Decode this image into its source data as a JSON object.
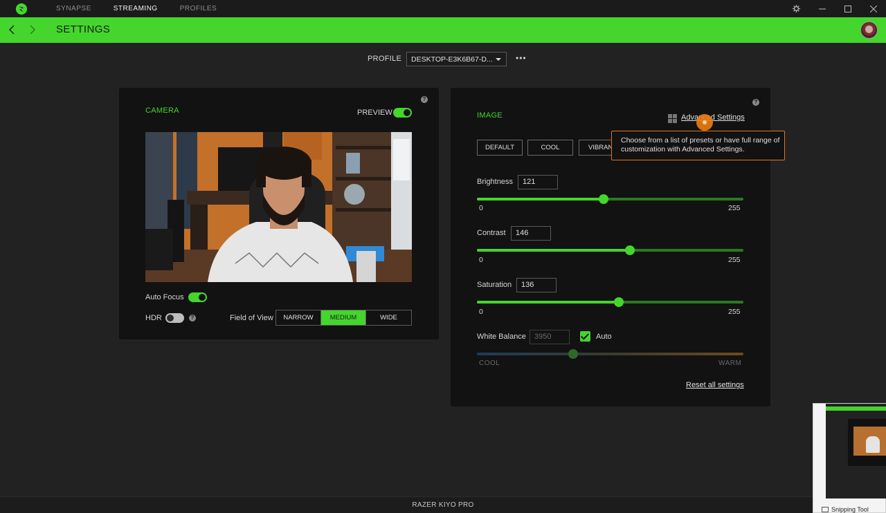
{
  "titlebar": {
    "nav": [
      "SYNAPSE",
      "STREAMING",
      "PROFILES"
    ],
    "active_nav": "STREAMING"
  },
  "header": {
    "title": "SETTINGS"
  },
  "profile": {
    "label": "PROFILE",
    "value": "DESKTOP-E3K6B67-D...",
    "more": "•••"
  },
  "camera": {
    "title": "CAMERA",
    "preview_label": "PREVIEW",
    "preview_on": true,
    "auto_focus_label": "Auto Focus",
    "auto_focus_on": true,
    "hdr_label": "HDR",
    "hdr_on": false,
    "fov_label": "Field of View",
    "fov_options": [
      "NARROW",
      "MEDIUM",
      "WIDE"
    ],
    "fov_selected": "MEDIUM"
  },
  "image": {
    "title": "IMAGE",
    "advanced_link": "Advanced Settings",
    "presets": [
      "DEFAULT",
      "COOL",
      "VIBRANT"
    ],
    "tooltip": "Choose from a list of presets or have full range of customization with Advanced Settings.",
    "brightness": {
      "label": "Brightness",
      "value": "121",
      "min": "0",
      "max": "255"
    },
    "contrast": {
      "label": "Contrast",
      "value": "146",
      "min": "0",
      "max": "255"
    },
    "saturation": {
      "label": "Saturation",
      "value": "136",
      "min": "0",
      "max": "255"
    },
    "white_balance": {
      "label": "White Balance",
      "value": "3950",
      "auto_label": "Auto",
      "auto_checked": true,
      "cool": "COOL",
      "warm": "WARM",
      "level": 0.36
    },
    "reset_link": "Reset all settings"
  },
  "footer": {
    "device": "RAZER KIYO PRO"
  },
  "snipping": {
    "label": "Snipping Tool"
  },
  "colors": {
    "accent": "#44d62c",
    "background": "#222222",
    "panel": "#121212",
    "tooltip_border": "#e5781d"
  }
}
